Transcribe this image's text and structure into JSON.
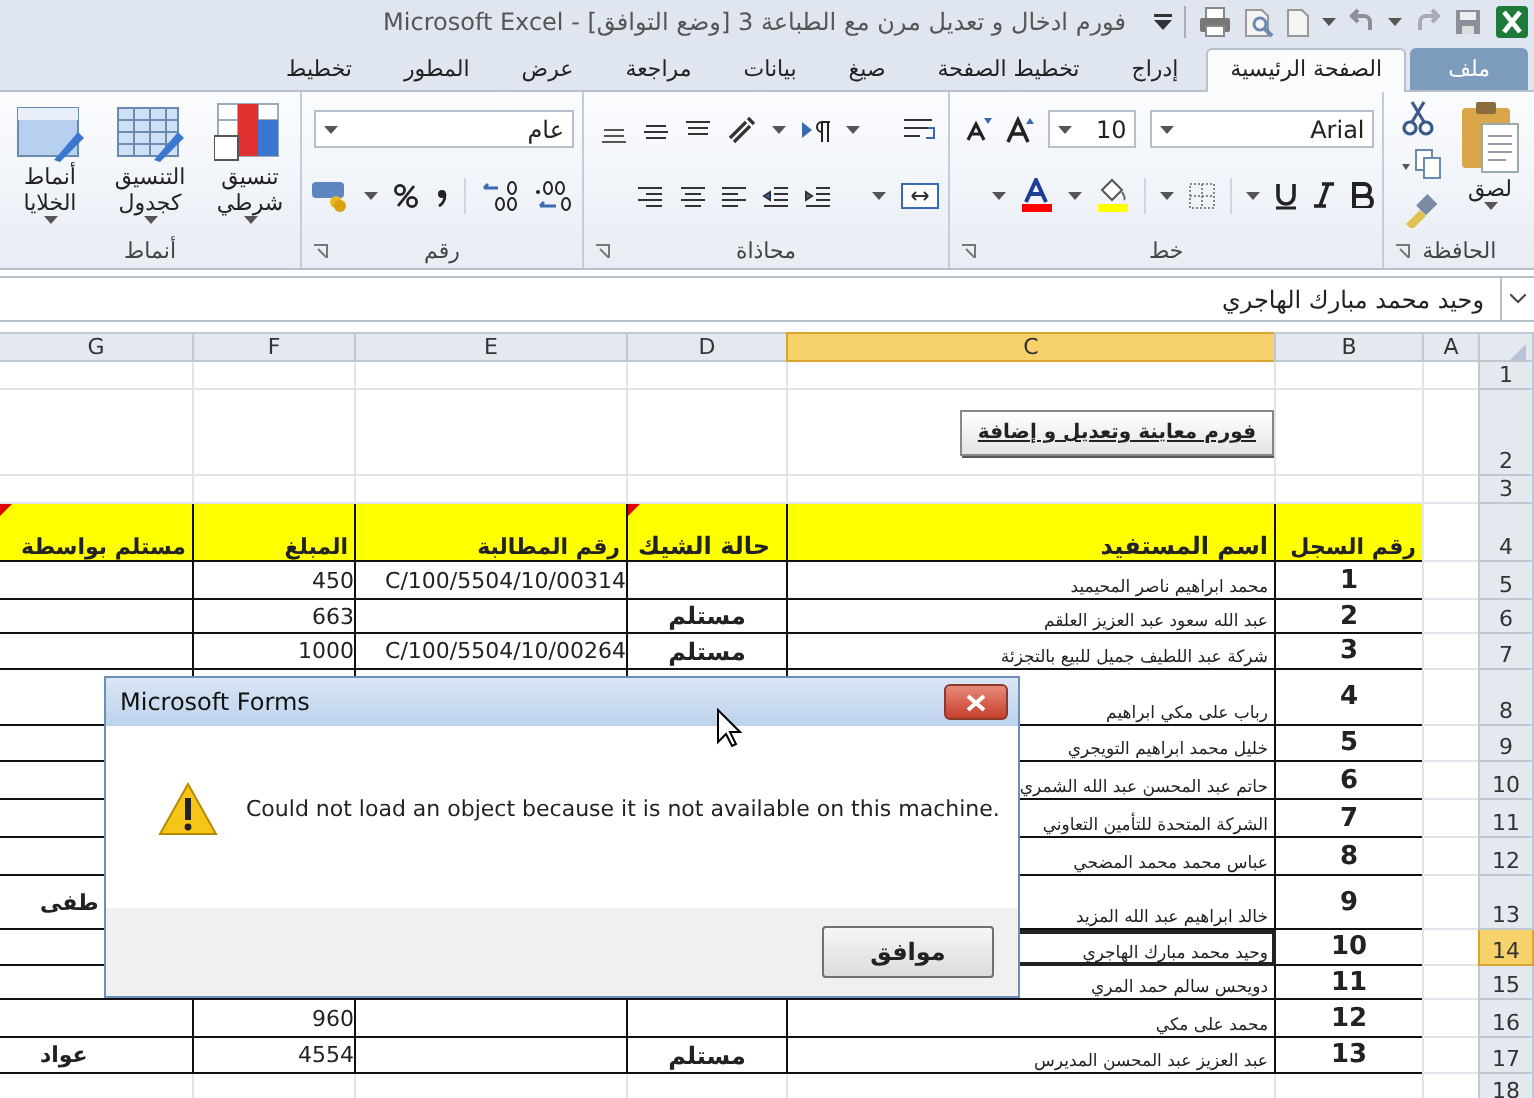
{
  "window": {
    "title": "فورم ادخال و تعديل مرن مع الطباعة 3  [وضع التوافق] - Microsoft Excel"
  },
  "tabs": [
    {
      "label": "ملف",
      "kind": "file",
      "selected": false
    },
    {
      "label": "الصفحة الرئيسية",
      "kind": "tab",
      "selected": true
    },
    {
      "label": "إدراج",
      "kind": "tab",
      "selected": false
    },
    {
      "label": "تخطيط الصفحة",
      "kind": "tab",
      "selected": false
    },
    {
      "label": "صيغ",
      "kind": "tab",
      "selected": false
    },
    {
      "label": "بيانات",
      "kind": "tab",
      "selected": false
    },
    {
      "label": "مراجعة",
      "kind": "tab",
      "selected": false
    },
    {
      "label": "عرض",
      "kind": "tab",
      "selected": false
    },
    {
      "label": "المطور",
      "kind": "tab",
      "selected": false
    },
    {
      "label": "تخطيط",
      "kind": "tab",
      "selected": false
    }
  ],
  "ribbon": {
    "groups": [
      {
        "kind": "clipboard",
        "title": "الحافظة",
        "paste_label": "لصق"
      },
      {
        "kind": "font",
        "title": "خط",
        "font_name": "Arial",
        "font_size": "10"
      },
      {
        "kind": "alignment",
        "title": "محاذاة"
      },
      {
        "kind": "number",
        "title": "رقم",
        "format": "عام"
      },
      {
        "kind": "styles",
        "title": "أنماط",
        "buttons": [
          "تنسيق شرطي",
          "التنسيق كجدول",
          "أنماط الخلايا"
        ]
      }
    ]
  },
  "formula_bar": {
    "value": "وحيد محمد مبارك الهاجري"
  },
  "sheet": {
    "columns": [
      {
        "label": "A",
        "selected": false
      },
      {
        "label": "B",
        "selected": false
      },
      {
        "label": "C",
        "selected": true
      },
      {
        "label": "D",
        "selected": false
      },
      {
        "label": "E",
        "selected": false
      },
      {
        "label": "F",
        "selected": false
      },
      {
        "label": "G",
        "selected": false
      }
    ],
    "rows": [
      {
        "label": "1",
        "selected": false,
        "kind": "blank"
      },
      {
        "label": "2",
        "selected": false,
        "kind": "button",
        "text": "فورم معاينة وتعديل و إضافة"
      },
      {
        "label": "3",
        "selected": false,
        "kind": "blank"
      },
      {
        "label": "4",
        "selected": false,
        "kind": "header",
        "cells": [
          {
            "text": "رقم السجل",
            "comment": false
          },
          {
            "text": "اسم المستفيد",
            "comment": false
          },
          {
            "text": "حالة الشيك",
            "comment": true
          },
          {
            "text": "رقم المطالبة",
            "comment": false
          },
          {
            "text": "المبلغ",
            "comment": false
          },
          {
            "text": "مستلم بواسطة",
            "comment": true
          }
        ]
      },
      {
        "label": "5",
        "selected": false,
        "kind": "record",
        "number": "1",
        "name": "محمد ابراهيم ناصر المحيميد",
        "claim": "C/100/5504/10/00314",
        "amount": "450",
        "active": false
      },
      {
        "label": "6",
        "selected": false,
        "kind": "record",
        "number": "2",
        "name": "عبد الله سعود عبد العزيز العلقم",
        "status": "مستلم",
        "amount": "663",
        "active": false
      },
      {
        "label": "7",
        "selected": false,
        "kind": "record",
        "number": "3",
        "name": "شركة عبد اللطيف جميل للبيع بالتجزئة",
        "status": "مستلم",
        "claim": "C/100/5504/10/00264",
        "amount": "1000",
        "active": false
      },
      {
        "label": "8",
        "selected": false,
        "kind": "record",
        "number": "4",
        "name": "رباب على مكي ابراهيم",
        "active": false
      },
      {
        "label": "9",
        "selected": false,
        "kind": "record",
        "number": "5",
        "name": "خليل محمد ابراهيم التويجري",
        "active": false
      },
      {
        "label": "10",
        "selected": false,
        "kind": "record",
        "number": "6",
        "name": "حاتم عبد المحسن عبد الله الشمري",
        "active": false
      },
      {
        "label": "11",
        "selected": false,
        "kind": "record",
        "number": "7",
        "name": "الشركة المتحدة للتأمين التعاوني",
        "active": false
      },
      {
        "label": "12",
        "selected": false,
        "kind": "record",
        "number": "8",
        "name": "عباس محمد محمد المضحي",
        "active": false
      },
      {
        "label": "13",
        "selected": false,
        "kind": "record",
        "number": "9",
        "name": "خالد ابراهيم عبد الله المزيد",
        "receiver": "طفى",
        "active": false
      },
      {
        "label": "14",
        "selected": true,
        "kind": "record",
        "number": "10",
        "name": "وحيد محمد مبارك الهاجري",
        "active": true
      },
      {
        "label": "15",
        "selected": false,
        "kind": "record",
        "number": "11",
        "name": "دويحس سالم حمد المري",
        "active": false
      },
      {
        "label": "16",
        "selected": false,
        "kind": "record",
        "number": "12",
        "name": "محمد على مكي",
        "amount": "960",
        "active": false
      },
      {
        "label": "17",
        "selected": false,
        "kind": "record",
        "number": "13",
        "name": "عبد العزيز عبد المحسن المديرس",
        "status": "مستلم",
        "amount": "4554",
        "receiver": "عواد",
        "active": false
      },
      {
        "label": "18",
        "selected": false,
        "kind": "blank"
      }
    ]
  },
  "dialog": {
    "title": "Microsoft Forms",
    "message": "Could not load an object because it is not available on this machine.",
    "button": "موافق"
  }
}
